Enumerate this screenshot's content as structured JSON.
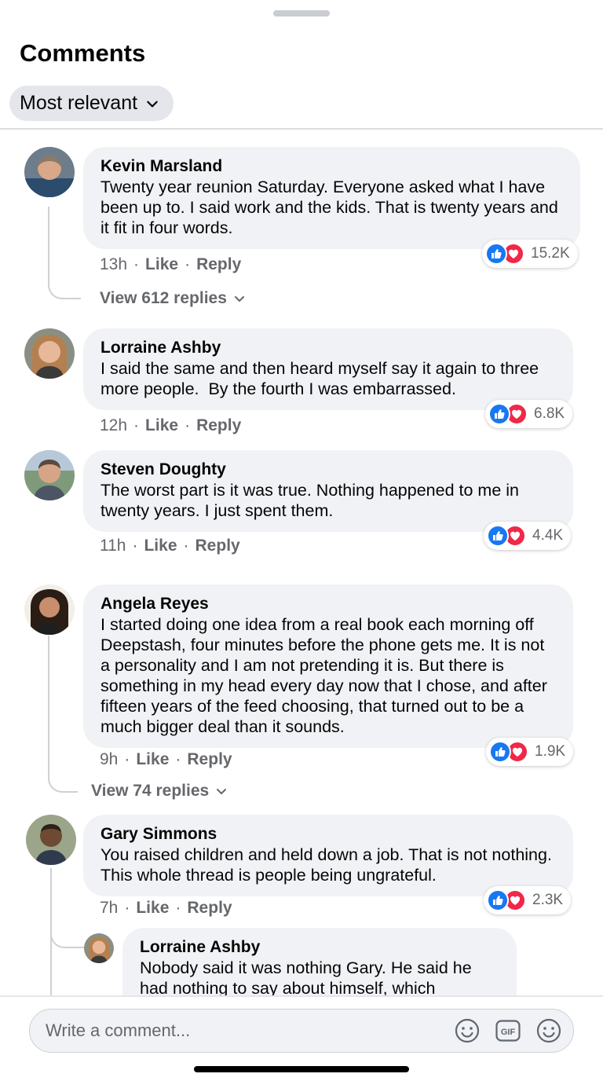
{
  "header": {
    "title": "Comments",
    "sort_label": "Most relevant"
  },
  "colors": {
    "like": "#1877f2",
    "love": "#f02849",
    "bubble": "#f0f2f5",
    "meta_text": "#65676b"
  },
  "comments": [
    {
      "name": "Kevin Marsland",
      "text": "Twenty year reunion Saturday. Everyone asked what I have been up to. I said work and the kids. That is twenty years and it fit in four words.",
      "time": "13h",
      "like_label": "Like",
      "reply_label": "Reply",
      "reactions": "15.2K",
      "view_replies": "View 612 replies"
    },
    {
      "name": "Lorraine Ashby",
      "text": "I said the same and then heard myself say it again to three more people.  By the fourth I was embarrassed.",
      "time": "12h",
      "like_label": "Like",
      "reply_label": "Reply",
      "reactions": "6.8K"
    },
    {
      "name": "Steven Doughty",
      "text": "The worst part is it was true. Nothing happened to me in twenty years. I just spent them.",
      "time": "11h",
      "like_label": "Like",
      "reply_label": "Reply",
      "reactions": "4.4K"
    },
    {
      "name": "Angela Reyes",
      "text": "I started doing one idea from a real book each morning off Deepstash, four minutes before the phone gets me. It is not a personality and I am not pretending it is. But there is something in my head every day now that I chose, and after fifteen years of the feed choosing, that turned out to be a much bigger deal than it sounds.",
      "time": "9h",
      "like_label": "Like",
      "reply_label": "Reply",
      "reactions": "1.9K",
      "view_replies": "View 74 replies"
    },
    {
      "name": "Gary Simmons",
      "text": "You raised children and held down a job. That is not nothing. This whole thread is people being ungrateful.",
      "time": "7h",
      "like_label": "Like",
      "reply_label": "Reply",
      "reactions": "2.3K"
    }
  ],
  "nested_reply": {
    "name": "Lorraine Ashby",
    "text": "Nobody said it was nothing Gary. He said he had nothing to say about himself, which"
  },
  "composer": {
    "placeholder": "Write a comment...",
    "icons": [
      "emoji-icon",
      "gif-icon",
      "sticker-icon"
    ]
  }
}
